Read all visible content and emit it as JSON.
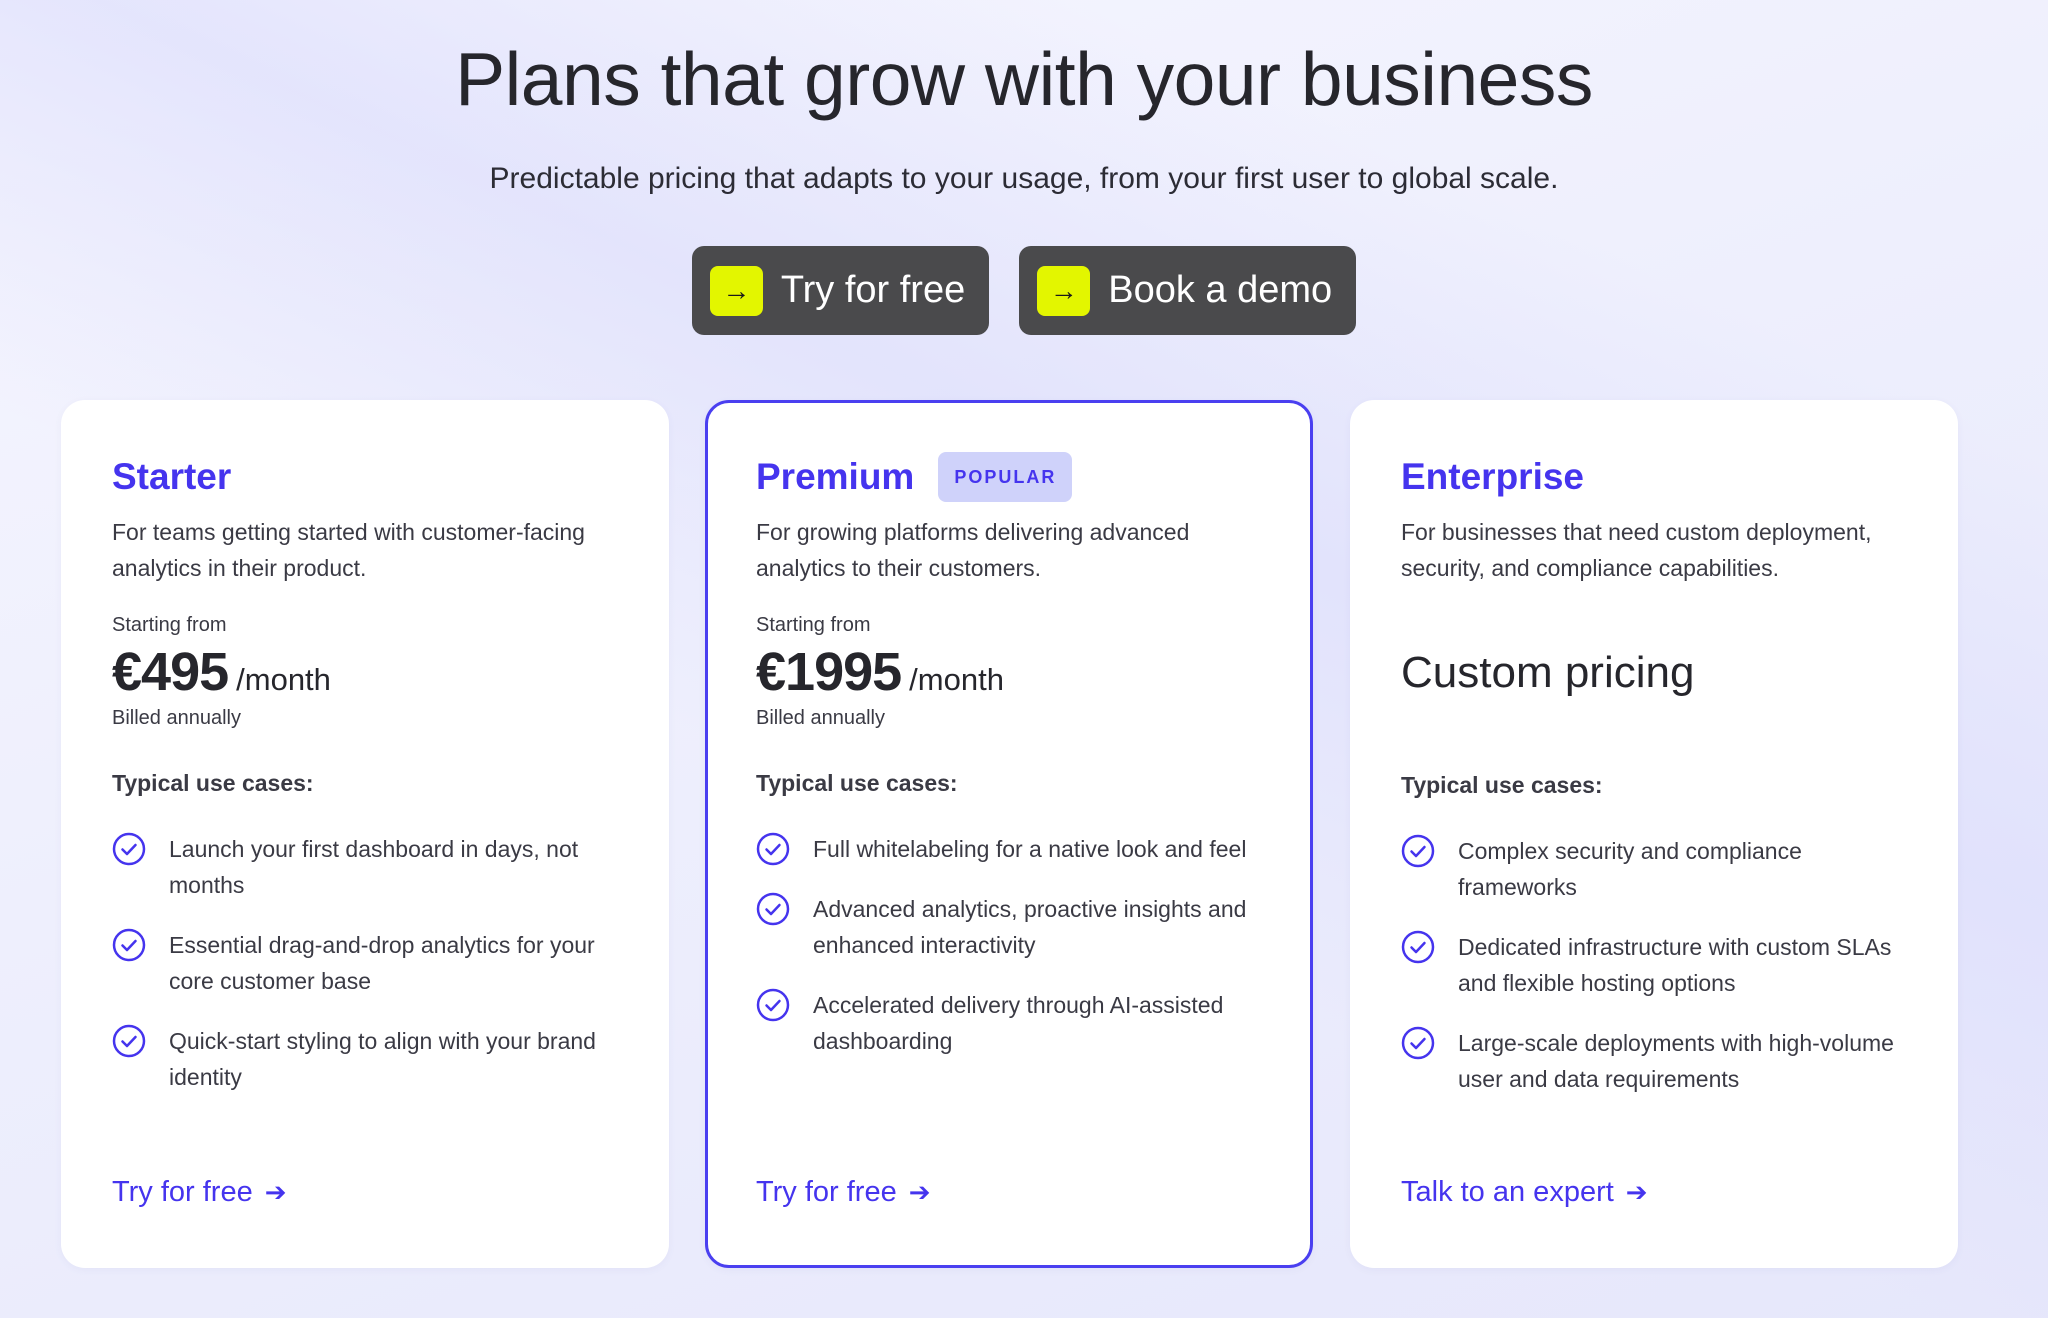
{
  "hero": {
    "title": "Plans that grow with your business",
    "subtitle": "Predictable pricing that adapts to your usage, from your first user to global scale.",
    "cta_primary": "Try for free",
    "cta_secondary": "Book a demo",
    "cta_icon": "arrow-right-icon"
  },
  "colors": {
    "accent": "#4534ee",
    "cta_bg": "#4a4a4c",
    "cta_icon_bg": "#e3f600",
    "popular_bg": "#cfd2fa"
  },
  "plans": [
    {
      "name": "Starter",
      "description": "For teams getting started with customer-facing analytics in their product.",
      "starting_from": "Starting from",
      "price": "€495",
      "period": "/month",
      "billing": "Billed annually",
      "use_cases_heading": "Typical use cases:",
      "features": [
        "Launch your first dashboard in days, not months",
        "Essential drag-and-drop analytics for your core customer base",
        "Quick-start styling to align with your brand identity"
      ],
      "link": "Try for free"
    },
    {
      "name": "Premium",
      "badge": "POPULAR",
      "description": "For growing platforms delivering advanced analytics to their customers.",
      "starting_from": "Starting from",
      "price": "€1995",
      "period": "/month",
      "billing": "Billed annually",
      "use_cases_heading": "Typical use cases:",
      "features": [
        "Full whitelabeling for a native look and feel",
        "Advanced analytics, proactive insights and enhanced interactivity",
        "Accelerated delivery through AI-assisted dashboarding"
      ],
      "link": "Try for free"
    },
    {
      "name": "Enterprise",
      "description": "For businesses that need custom deployment, security, and compliance capabilities.",
      "custom_price": "Custom pricing",
      "use_cases_heading": "Typical use cases:",
      "features": [
        "Complex security and compliance frameworks",
        "Dedicated infrastructure with custom SLAs and flexible hosting options",
        "Large-scale deployments with high-volume user and data requirements"
      ],
      "link": "Talk to an expert"
    }
  ]
}
